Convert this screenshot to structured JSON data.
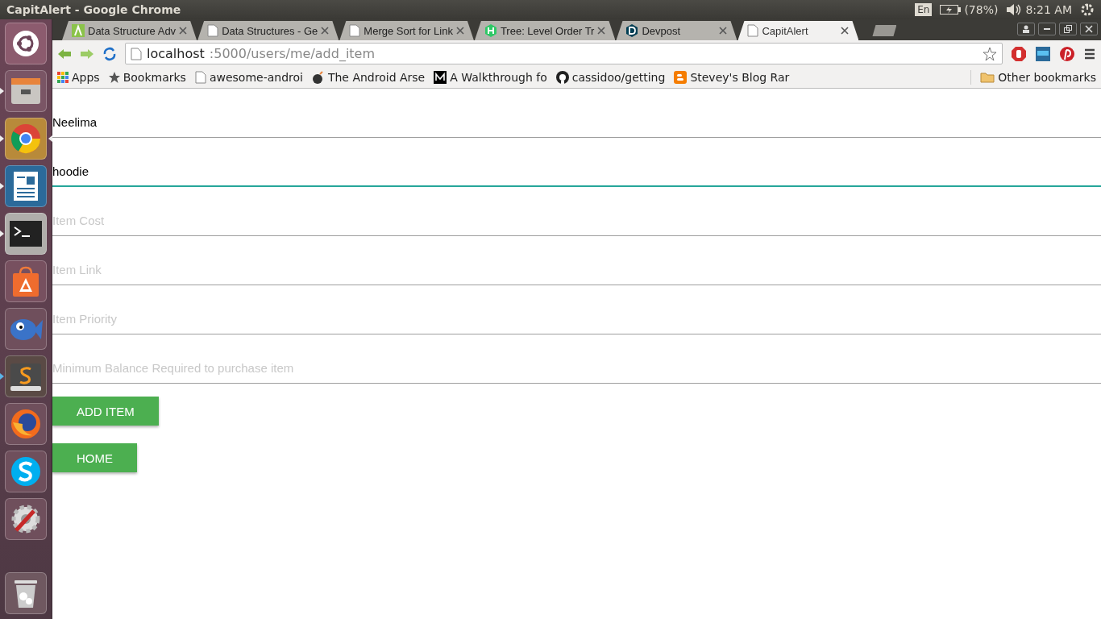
{
  "top_panel": {
    "title": "CapitAlert - Google Chrome",
    "keyboard": "En",
    "battery": "(78%)",
    "time": "8:21 AM"
  },
  "launcher": {
    "items": [
      {
        "kind": "ubuntu",
        "running": false,
        "focused": false
      },
      {
        "kind": "files",
        "running": true,
        "focused": false
      },
      {
        "kind": "chrome",
        "running": true,
        "focused": true
      },
      {
        "kind": "writer",
        "running": true,
        "focused": false
      },
      {
        "kind": "terminal",
        "running": true,
        "focused": false
      },
      {
        "kind": "store",
        "running": false,
        "focused": false
      },
      {
        "kind": "fish",
        "running": false,
        "focused": false
      },
      {
        "kind": "sublime",
        "running": true,
        "focused": false
      },
      {
        "kind": "firefox",
        "running": false,
        "focused": false
      },
      {
        "kind": "skype",
        "running": false,
        "focused": false
      },
      {
        "kind": "settings",
        "running": false,
        "focused": false
      },
      {
        "kind": "trash",
        "running": false,
        "focused": false
      }
    ]
  },
  "tabs": [
    {
      "label": "Data Structure Adv",
      "kind": "lambda",
      "selected": false
    },
    {
      "label": "Data Structures - Ge",
      "kind": "page",
      "selected": false
    },
    {
      "label": "Merge Sort for Link",
      "kind": "page",
      "selected": false
    },
    {
      "label": "Tree: Level Order Tr",
      "kind": "h",
      "selected": false
    },
    {
      "label": "Devpost",
      "kind": "d",
      "selected": false
    },
    {
      "label": "CapitAlert",
      "kind": "page",
      "selected": true
    }
  ],
  "address_bar": {
    "host": "localhost",
    "path": ":5000/users/me/add_item"
  },
  "bookmarks": [
    {
      "label": "Apps",
      "kind": "apps"
    },
    {
      "label": "Bookmarks",
      "kind": "star"
    },
    {
      "label": "awesome-androi",
      "kind": "page"
    },
    {
      "label": "The Android Arse",
      "kind": "bomb"
    },
    {
      "label": "A Walkthrough fo",
      "kind": "medium"
    },
    {
      "label": "cassidoo/getting",
      "kind": "github"
    },
    {
      "label": "Stevey's Blog Rar",
      "kind": "blogger"
    }
  ],
  "other_bookmarks": "Other bookmarks",
  "form": {
    "fields": [
      {
        "value": "Neelima",
        "focused": false
      },
      {
        "value": "hoodie",
        "focused": true
      },
      {
        "placeholder": "Item Cost",
        "focused": false
      },
      {
        "placeholder": "Item Link",
        "focused": false
      },
      {
        "placeholder": "Item Priority",
        "focused": false
      },
      {
        "placeholder": "Minimum Balance Required to purchase item",
        "focused": false
      }
    ],
    "buttons": [
      "ADD ITEM",
      "HOME"
    ]
  }
}
